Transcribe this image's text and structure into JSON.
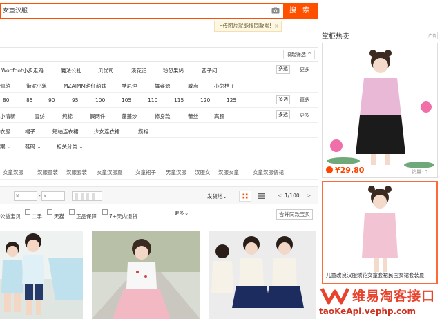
{
  "search": {
    "query": "女童汉服",
    "button": "搜 索",
    "tip": "上传图片就能搜同款啦!",
    "tip_close": "×"
  },
  "filter": {
    "collapse": "收起筛选 ^",
    "brand_row": [
      "Woofoot小步走路",
      "魔法公社",
      "贝优司",
      "溪花记",
      "粉恐果鸠",
      "西子问"
    ],
    "style_row": [
      "佩萌",
      "街泥小筑",
      "MZAIMM萌仔萌妹",
      "酷尼迪",
      "舞姿源",
      "威点",
      "小兔桔子"
    ],
    "size_row": [
      "80",
      "85",
      "90",
      "95",
      "100",
      "105",
      "110",
      "115",
      "120",
      "125"
    ],
    "material_row": [
      "小清新",
      "雪纺",
      "纯棉",
      "假两件",
      "蓬蓬纱",
      "修身款",
      "蕾丝",
      "高腰"
    ],
    "type_row": [
      "衣服",
      "裙子",
      "短袖连衣裙",
      "少女连衣裙",
      "旗袍"
    ],
    "multi": "多选",
    "more": "更多",
    "cat_row": [
      "案 ⌄",
      "鞋码 ⌄",
      "相关分类 ⌄"
    ]
  },
  "tags": [
    "女童汉服",
    "汉服童装",
    "汉服套装",
    "女童汉服夏",
    "女童裙子",
    "男童汉服",
    "汉服女",
    "汉服女童",
    "女童汉服儒裙"
  ],
  "sort": {
    "price_from": "¥",
    "dash": "-",
    "price_to": "¥",
    "ship": "发货地⌄",
    "page": "1/100",
    "prev": "<",
    "next": ">"
  },
  "checks": {
    "items": [
      "公益宝贝",
      "二手",
      "天猫",
      "正品保障",
      "7+天内退货"
    ],
    "more": "更多⌄",
    "merge": "合并同款宝贝"
  },
  "sidebar": {
    "title": "掌柜热卖",
    "ad_label": "广告",
    "price": "¥29.80",
    "sales": "销量: 0",
    "caption": "儿童改良汉服绣花女童套裙民国女裙套装夏"
  },
  "watermark": {
    "brand": "维易淘客接口",
    "url": "taoKeApi.vephp.com"
  }
}
